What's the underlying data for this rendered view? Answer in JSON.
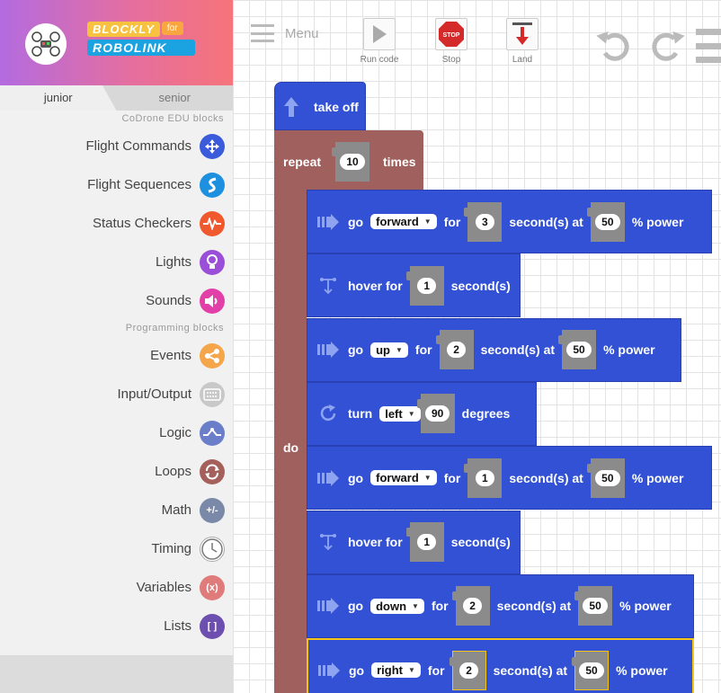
{
  "brand": {
    "top": "BLOCKLY",
    "for": "for",
    "bottom": "ROBOLINK"
  },
  "tabs": [
    {
      "label": "junior"
    },
    {
      "label": "senior"
    }
  ],
  "sidebar": {
    "section1": "CoDrone EDU blocks",
    "section2": "Programming blocks",
    "items": [
      {
        "label": "Flight Commands",
        "color": "#3b5bdb",
        "icon": "drone-arrows-icon"
      },
      {
        "label": "Flight Sequences",
        "color": "#1e90e0",
        "icon": "s-curve-icon"
      },
      {
        "label": "Status Checkers",
        "color": "#f0582e",
        "icon": "pulse-icon"
      },
      {
        "label": "Lights",
        "color": "#9b4fd8",
        "icon": "bulb-icon"
      },
      {
        "label": "Sounds",
        "color": "#e23fa8",
        "icon": "speaker-icon"
      },
      {
        "label": "Events",
        "color": "#f5a54a",
        "icon": "share-icon"
      },
      {
        "label": "Input/Output",
        "color": "#c8c8c8",
        "icon": "keyboard-icon"
      },
      {
        "label": "Logic",
        "color": "#6b7ec9",
        "icon": "logic-icon"
      },
      {
        "label": "Loops",
        "color": "#a5605c",
        "icon": "loop-icon"
      },
      {
        "label": "Math",
        "color": "#7a89a8",
        "icon": "math-icon",
        "glyph": "+/-"
      },
      {
        "label": "Timing",
        "color": "#ffffff",
        "icon": "clock-icon"
      },
      {
        "label": "Variables",
        "color": "#e07b7b",
        "icon": "variable-icon",
        "glyph": "(x)"
      },
      {
        "label": "Lists",
        "color": "#6d4fb0",
        "icon": "list-icon",
        "glyph": "[ ]"
      }
    ]
  },
  "toolbar": {
    "menu": "Menu",
    "run": "Run code",
    "stop": "Stop",
    "stop_glyph": "STOP",
    "land": "Land"
  },
  "blocks": {
    "takeoff": "take off",
    "repeat": "repeat",
    "times": "times",
    "do": "do",
    "repeat_count": "10",
    "rows": [
      {
        "kind": "go",
        "t1": "go",
        "dir": "forward",
        "t2": "for",
        "v1": "3",
        "t3": "second(s) at",
        "v2": "50",
        "t4": "% power"
      },
      {
        "kind": "hover",
        "t1": "hover for",
        "v1": "1",
        "t3": "second(s)"
      },
      {
        "kind": "go",
        "t1": "go",
        "dir": "up",
        "t2": "for",
        "v1": "2",
        "t3": "second(s) at",
        "v2": "50",
        "t4": "% power"
      },
      {
        "kind": "turn",
        "t1": "turn",
        "dir": "left",
        "v1": "90",
        "t3": "degrees"
      },
      {
        "kind": "go",
        "t1": "go",
        "dir": "forward",
        "t2": "for",
        "v1": "1",
        "t3": "second(s) at",
        "v2": "50",
        "t4": "% power"
      },
      {
        "kind": "hover",
        "t1": "hover for",
        "v1": "1",
        "t3": "second(s)"
      },
      {
        "kind": "go",
        "t1": "go",
        "dir": "down",
        "t2": "for",
        "v1": "2",
        "t3": "second(s) at",
        "v2": "50",
        "t4": "% power"
      },
      {
        "kind": "go",
        "t1": "go",
        "dir": "right",
        "t2": "for",
        "v1": "2",
        "t3": "second(s) at",
        "v2": "50",
        "t4": "% power"
      }
    ]
  }
}
